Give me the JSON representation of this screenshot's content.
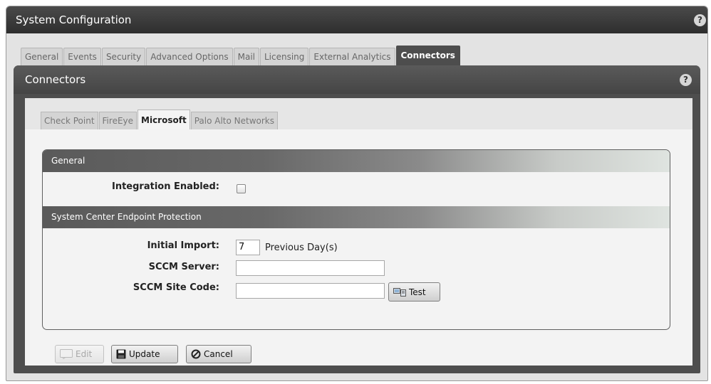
{
  "window": {
    "title": "System Configuration",
    "help": "?"
  },
  "main_tabs": [
    {
      "label": "General",
      "active": false
    },
    {
      "label": "Events",
      "active": false
    },
    {
      "label": "Security",
      "active": false
    },
    {
      "label": "Advanced Options",
      "active": false
    },
    {
      "label": "Mail",
      "active": false
    },
    {
      "label": "Licensing",
      "active": false
    },
    {
      "label": "External Analytics",
      "active": false
    },
    {
      "label": "Connectors",
      "active": true
    }
  ],
  "panel": {
    "title": "Connectors",
    "help": "?"
  },
  "connector_tabs": [
    {
      "label": "Check Point",
      "active": false
    },
    {
      "label": "FireEye",
      "active": false
    },
    {
      "label": "Microsoft",
      "active": true
    },
    {
      "label": "Palo Alto Networks",
      "active": false
    }
  ],
  "general": {
    "heading": "General",
    "integration_label": "Integration Enabled:",
    "integration_enabled": false
  },
  "scep": {
    "heading": "System Center Endpoint Protection",
    "initial_import_label": "Initial Import:",
    "initial_import_value": "7",
    "initial_import_suffix": "Previous Day(s)",
    "sccm_server_label": "SCCM Server:",
    "sccm_server_value": "",
    "sccm_site_code_label": "SCCM Site Code:",
    "sccm_site_code_value": "",
    "test_label": "Test"
  },
  "footer": {
    "edit_label": "Edit",
    "update_label": "Update",
    "cancel_label": "Cancel"
  },
  "colors": {
    "title_bar": "#3a3a3a",
    "panel": "#4e4e4e",
    "background": "#e3e3e3"
  }
}
